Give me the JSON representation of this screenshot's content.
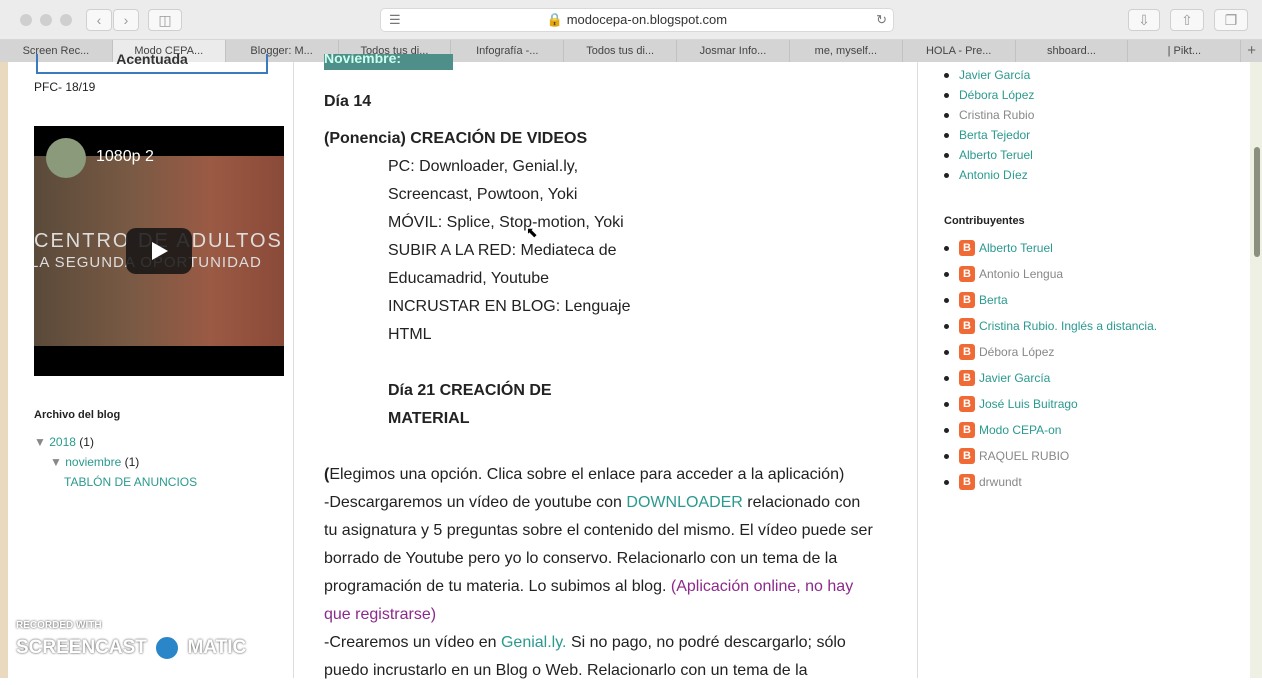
{
  "browser": {
    "url": "modocepa-on.blogspot.com",
    "tabs": [
      "Screen Rec...",
      "Modo CEPA...",
      "Blogger: M...",
      "Todos tus di...",
      "Infografía -...",
      "Todos tus di...",
      "Josmar Info...",
      "me, myself...",
      "HOLA - Pre...",
      "shboard...",
      "| Pikt..."
    ],
    "active_tab": 1,
    "new_tab": "+"
  },
  "left": {
    "banner_text": "Acentuada",
    "pfc": "PFC- 18/19",
    "video": {
      "title": "1080p 2",
      "overlay1": "CENTRO  DE  ADULTOS",
      "overlay2": "LA SEGUNDA OPORTUNIDAD"
    },
    "archive_title": "Archivo del blog",
    "year": "2018",
    "year_count": "(1)",
    "month": "noviembre",
    "month_count": "(1)",
    "post": "TABLÓN DE ANUNCIOS"
  },
  "main": {
    "header": "Noviembre:",
    "day14": "Día 14",
    "ponencia_pre": "(Ponencia) ",
    "ponencia": "CREACIÓN DE VIDEOS",
    "lines": [
      "PC: Downloader, Genial.ly,",
      "Screencast, Powtoon, Yoki",
      "MÓVIL: Splice, Stop-motion, Yoki",
      "SUBIR A LA RED: Mediateca de",
      "Educamadrid, Youtube",
      "INCRUSTAR EN BLOG: Lenguaje",
      "HTML"
    ],
    "day21a": "Día 21 CREACIÓN DE",
    "day21b": "MATERIAL",
    "p1_paren": "(",
    "p1": "Elegimos una opción. Clica sobre el enlace para acceder a la aplicación)",
    "p2a": "-Descargaremos un vídeo de youtube con ",
    "p2link": "DOWNLOADER",
    "p2b": " relacionado con",
    "p3": "tu asignatura y 5 preguntas sobre el contenido del mismo. El vídeo puede ser",
    "p4": "borrado de Youtube pero yo lo conservo. Relacionarlo con un tema de la",
    "p5": "programación de tu materia. Lo subimos al blog. ",
    "p5p": "(Aplicación online, no hay",
    "p6p": "que registrarse)",
    "p7a": "-Crearemos un vídeo en ",
    "p7link": "Genial.ly.",
    "p7b": " Si no pago, no podré descargarlo; sólo",
    "p8": "puedo incrustarlo en un Blog o Web. Relacionarlo con un tema de la"
  },
  "right": {
    "followers": [
      {
        "name": "Javier García",
        "grey": false
      },
      {
        "name": "Débora López",
        "grey": false
      },
      {
        "name": "Cristina Rubio",
        "grey": true
      },
      {
        "name": "Berta Tejedor",
        "grey": false
      },
      {
        "name": "Alberto Teruel",
        "grey": false
      },
      {
        "name": "Antonio Díez",
        "grey": false
      }
    ],
    "contrib_title": "Contribuyentes",
    "contributors": [
      {
        "name": "Alberto Teruel",
        "grey": false
      },
      {
        "name": "Antonio Lengua",
        "grey": true
      },
      {
        "name": "Berta",
        "grey": false
      },
      {
        "name": "Cristina Rubio. Inglés a distancia.",
        "grey": false
      },
      {
        "name": "Débora López",
        "grey": true
      },
      {
        "name": "Javier García",
        "grey": false
      },
      {
        "name": "José Luis Buitrago",
        "grey": false
      },
      {
        "name": "Modo CEPA-on",
        "grey": false
      },
      {
        "name": "RAQUEL RUBIO",
        "grey": true
      },
      {
        "name": "drwundt",
        "grey": true
      }
    ]
  },
  "watermark": {
    "top": "RECORDED WITH",
    "left": "SCREENCAST",
    "right": "MATIC"
  },
  "colors": {
    "link": "#2a9a8e",
    "purple": "#8b2a8b",
    "blogger": "#f06a35"
  }
}
